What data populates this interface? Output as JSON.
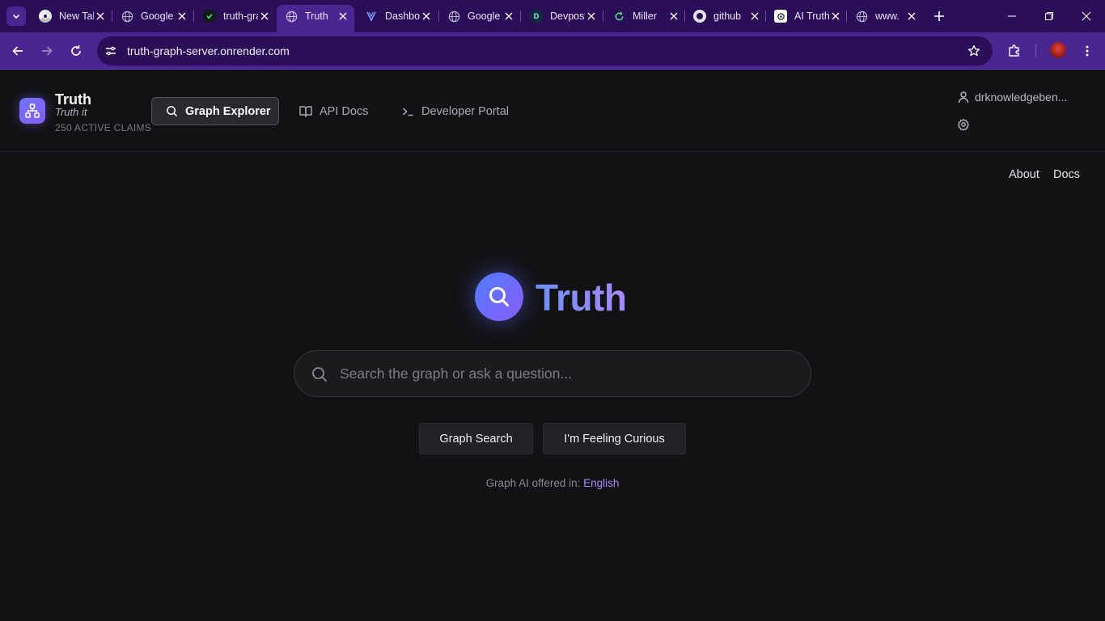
{
  "browser": {
    "tabs": [
      {
        "title": "New Tab",
        "favicon": "chrome-icon",
        "active": false
      },
      {
        "title": "Google",
        "favicon": "globe-icon",
        "active": false
      },
      {
        "title": "truth-graph",
        "favicon": "check-icon",
        "active": false
      },
      {
        "title": "Truth",
        "favicon": "globe-icon",
        "active": true
      },
      {
        "title": "Dashboard",
        "favicon": "layers-icon",
        "active": false
      },
      {
        "title": "Google",
        "favicon": "globe-icon",
        "active": false
      },
      {
        "title": "Devpost",
        "favicon": "d-icon",
        "active": false
      },
      {
        "title": "Miller",
        "favicon": "refresh-icon",
        "active": false
      },
      {
        "title": "github",
        "favicon": "github-icon",
        "active": false
      },
      {
        "title": "AI Truth",
        "favicon": "openai-icon",
        "active": false
      },
      {
        "title": "www.",
        "favicon": "globe-icon",
        "active": false
      }
    ],
    "url": "truth-graph-server.onrender.com",
    "colors": {
      "tabstrip": "#2a0f58",
      "toolbar": "#4b2591"
    }
  },
  "header": {
    "brand_name": "Truth",
    "brand_tagline": "Truth it",
    "claims_label": "250 ACTIVE CLAIMS",
    "nav": {
      "graph_explorer": "Graph Explorer",
      "api_docs": "API Docs",
      "developer_portal": "Developer Portal"
    },
    "user_name": "drknowledgeben..."
  },
  "top_links": {
    "about": "About",
    "docs": "Docs"
  },
  "hero": {
    "title": "Truth",
    "search_placeholder": "Search the graph or ask a question...",
    "search_value": "",
    "graph_search_label": "Graph Search",
    "curious_label": "I'm Feeling Curious",
    "offered_in_label": "Graph AI offered in:",
    "language": "English",
    "accent": "#a78bfa"
  }
}
